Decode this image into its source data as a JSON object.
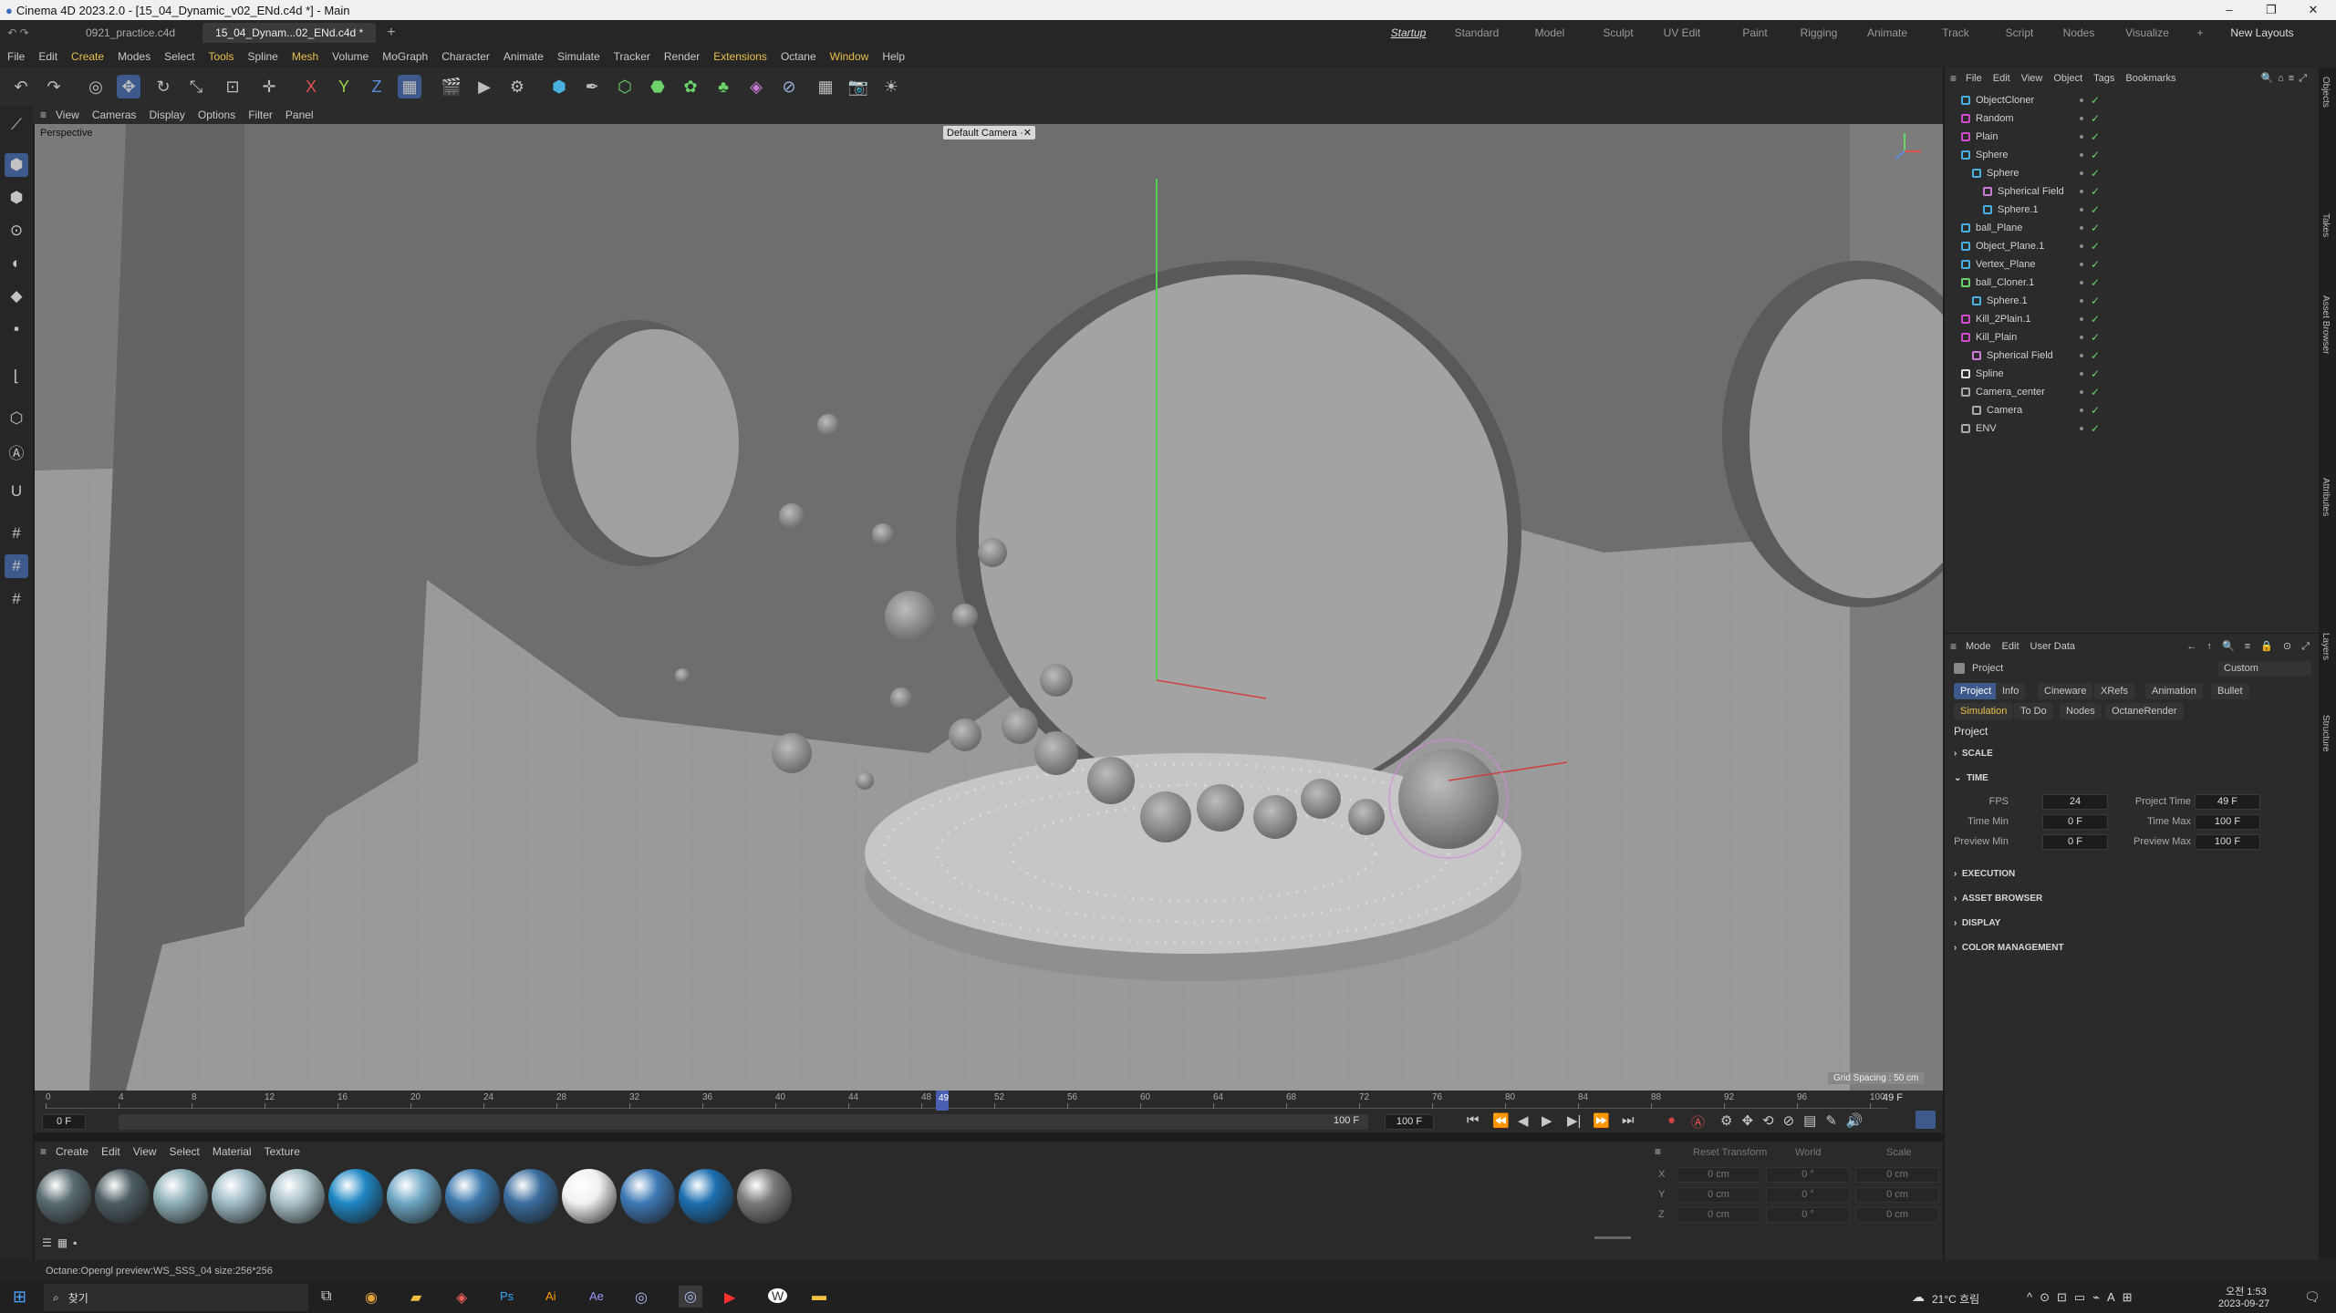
{
  "window": {
    "title": "Cinema 4D 2023.2.0 - [15_04_Dynamic_v02_ENd.c4d *] - Main"
  },
  "doc_tabs": [
    "0921_practice.c4d",
    "15_04_Dynam...02_ENd.c4d *"
  ],
  "layouts": [
    "Startup",
    "Standard",
    "Model",
    "Sculpt",
    "UV Edit",
    "Paint",
    "Rigging",
    "Animate",
    "Track",
    "Script",
    "Nodes",
    "Visualize"
  ],
  "new_layouts": "New Layouts",
  "menu": [
    "File",
    "Edit",
    "Create",
    "Modes",
    "Select",
    "Tools",
    "Spline",
    "Mesh",
    "Volume",
    "MoGraph",
    "Character",
    "Animate",
    "Simulate",
    "Tracker",
    "Render",
    "Extensions",
    "Octane",
    "Window",
    "Help"
  ],
  "viewport": {
    "menu": [
      "View",
      "Cameras",
      "Display",
      "Options",
      "Filter",
      "Panel"
    ],
    "name": "Perspective",
    "camera": "Default Camera",
    "grid_spacing": "Grid Spacing : 50 cm"
  },
  "timeline": {
    "ticks": [
      "0",
      "4",
      "8",
      "12",
      "16",
      "20",
      "24",
      "28",
      "32",
      "36",
      "40",
      "44",
      "48",
      "52",
      "56",
      "60",
      "64",
      "68",
      "72",
      "76",
      "80",
      "84",
      "88",
      "92",
      "96",
      "100"
    ],
    "current": "49",
    "current_frame_label": "49 F",
    "start": "0 F",
    "start2": "0 F",
    "end": "100 F",
    "end2": "100 F",
    "current_fraction": 0.49
  },
  "materials": {
    "menu": [
      "Create",
      "Edit",
      "View",
      "Select",
      "Material",
      "Texture"
    ],
    "swatches": [
      "#5a6b70",
      "#4d5d62",
      "#8fb0b8",
      "#9fbcc6",
      "#a9c2c8",
      "#1f87c4",
      "#6da6c4",
      "#3c79ad",
      "#3a6d9e",
      "#f2f2f2",
      "#3d79b5",
      "#1d6fb0",
      "#7a7a7a"
    ]
  },
  "coords": {
    "header": [
      "Reset Transform",
      "World",
      "Scale"
    ],
    "rows": [
      {
        "axis": "X",
        "a": "0 cm",
        "b": "0 °",
        "c": "0 cm"
      },
      {
        "axis": "Y",
        "a": "0 cm",
        "b": "0 °",
        "c": "0 cm"
      },
      {
        "axis": "Z",
        "a": "0 cm",
        "b": "0 °",
        "c": "0 cm"
      }
    ]
  },
  "objects_panel": {
    "menu": [
      "File",
      "Edit",
      "View",
      "Object",
      "Tags",
      "Bookmarks"
    ],
    "items": [
      {
        "name": "ObjectCloner",
        "indent": 0,
        "icon": "#4ab0e0"
      },
      {
        "name": "Random",
        "indent": 0,
        "icon": "#d04ac8"
      },
      {
        "name": "Plain",
        "indent": 0,
        "icon": "#d04ac8"
      },
      {
        "name": "Sphere",
        "indent": 0,
        "icon": "#4ab0e0"
      },
      {
        "name": "Sphere",
        "indent": 1,
        "icon": "#4ab0e0"
      },
      {
        "name": "Spherical Field",
        "indent": 2,
        "icon": "#c97bd6"
      },
      {
        "name": "Sphere.1",
        "indent": 2,
        "icon": "#4ab0e0"
      },
      {
        "name": "ball_Plane",
        "indent": 0,
        "icon": "#4ab0e0"
      },
      {
        "name": "Object_Plane.1",
        "indent": 0,
        "icon": "#4ab0e0"
      },
      {
        "name": "Vertex_Plane",
        "indent": 0,
        "icon": "#4ab0e0"
      },
      {
        "name": "ball_Cloner.1",
        "indent": 0,
        "icon": "#6cd36c"
      },
      {
        "name": "Sphere.1",
        "indent": 1,
        "icon": "#4ab0e0"
      },
      {
        "name": "Kill_2Plain.1",
        "indent": 0,
        "icon": "#d04ac8"
      },
      {
        "name": "Kill_Plain",
        "indent": 0,
        "icon": "#d04ac8"
      },
      {
        "name": "Spherical Field",
        "indent": 1,
        "icon": "#c97bd6"
      },
      {
        "name": "Spline",
        "indent": 0,
        "icon": "#e0e0e0"
      },
      {
        "name": "Camera_center",
        "indent": 0,
        "icon": "#aaaaaa"
      },
      {
        "name": "Camera",
        "indent": 1,
        "icon": "#aaaaaa"
      },
      {
        "name": "ENV",
        "indent": 0,
        "icon": "#aaaaaa"
      }
    ]
  },
  "attributes": {
    "menu": [
      "Mode",
      "Edit",
      "User Data"
    ],
    "title": "Project",
    "dropdown": "Custom",
    "tabs_row1": [
      "Project",
      "Info",
      "Cineware",
      "XRefs",
      "Animation",
      "Bullet"
    ],
    "tabs_row2": [
      "Simulation",
      "To Do",
      "Nodes",
      "OctaneRender"
    ],
    "heading": "Project",
    "sections": [
      "SCALE",
      "TIME",
      "EXECUTION",
      "ASSET BROWSER",
      "DISPLAY",
      "COLOR MANAGEMENT"
    ],
    "time": {
      "fps_label": "FPS",
      "fps": "24",
      "project_time_label": "Project Time",
      "project_time": "49 F",
      "time_min_label": "Time Min",
      "time_min": "0 F",
      "time_max_label": "Time Max",
      "time_max": "100 F",
      "preview_min_label": "Preview Min",
      "preview_min": "0 F",
      "preview_max_label": "Preview Max",
      "preview_max": "100 F"
    }
  },
  "right_strip": [
    "Objects",
    "Takes",
    "Asset Browser",
    "Attributes",
    "Layers",
    "Structure"
  ],
  "status": "Octane:Opengl preview:WS_SSS_04  size:256*256",
  "taskbar": {
    "search": "찾기",
    "weather": "21°C 흐림",
    "time": "오전 1:53",
    "date": "2023-09-27"
  }
}
